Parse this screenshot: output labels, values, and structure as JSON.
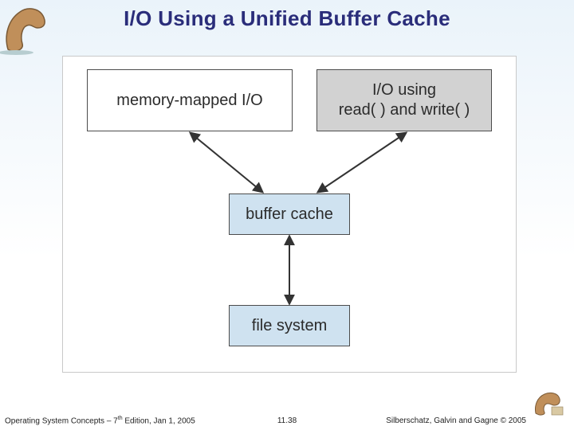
{
  "title": "I/O Using a Unified Buffer Cache",
  "boxes": {
    "memory_mapped": "memory-mapped I/O",
    "read_write": "I/O using\nread( ) and write( )",
    "buffer_cache": "buffer cache",
    "file_system": "file system"
  },
  "footer": {
    "left_prefix": "Operating System Concepts – 7",
    "left_ord": "th",
    "left_suffix": " Edition, Jan 1, 2005",
    "center": "11.38",
    "right": "Silberschatz, Galvin and Gagne © 2005"
  },
  "icons": {
    "top_logo": "dinosaur-logo-icon",
    "bottom_logo": "dinosaur-logo-icon"
  },
  "chart_data": {
    "type": "diagram",
    "title": "I/O Using a Unified Buffer Cache",
    "nodes": [
      {
        "id": "memory_mapped",
        "label": "memory-mapped I/O",
        "fill": "white"
      },
      {
        "id": "read_write",
        "label": "I/O using read( ) and write( )",
        "fill": "grey"
      },
      {
        "id": "buffer_cache",
        "label": "buffer cache",
        "fill": "lightblue"
      },
      {
        "id": "file_system",
        "label": "file system",
        "fill": "lightblue"
      }
    ],
    "edges": [
      {
        "from": "memory_mapped",
        "to": "buffer_cache",
        "bidirectional": true
      },
      {
        "from": "read_write",
        "to": "buffer_cache",
        "bidirectional": true
      },
      {
        "from": "buffer_cache",
        "to": "file_system",
        "bidirectional": true
      }
    ]
  }
}
